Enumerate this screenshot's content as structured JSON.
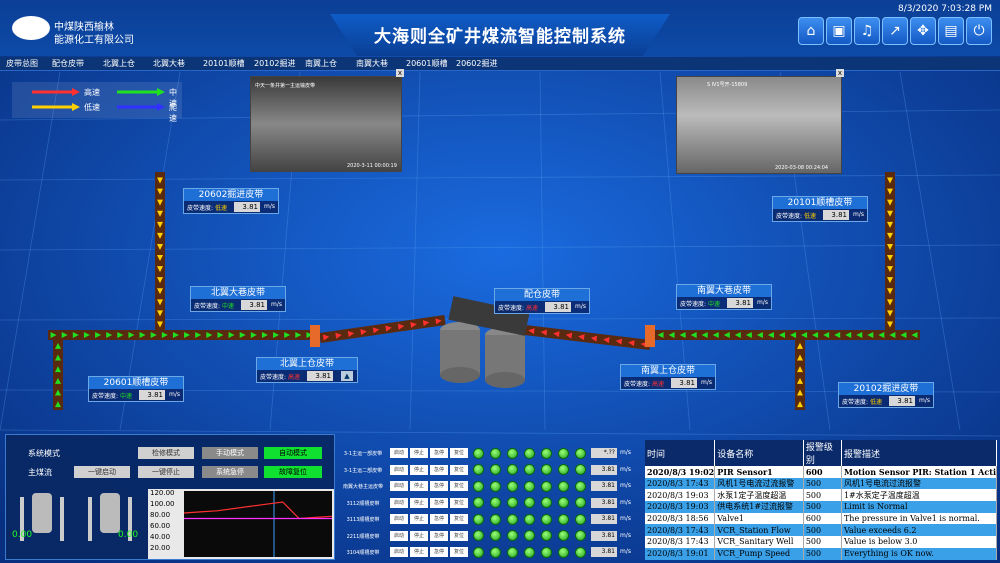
{
  "header": {
    "company_line1": "中煤陕西榆林",
    "company_line2": "能源化工有限公司",
    "title": "大海则全矿井煤流智能控制系统",
    "datetime": "8/3/2020 7:03:28 PM",
    "buttons": [
      "home-icon",
      "camera-icon",
      "alarm-bell-icon",
      "trend-chart-icon",
      "move-arrows-icon",
      "table-icon",
      "power-icon"
    ]
  },
  "tabs": [
    "皮带总图",
    "配仓皮带",
    "北翼上仓",
    "北翼大巷",
    "20101顺槽",
    "20102掘进",
    "南翼上仓",
    "南翼大巷",
    "20601顺槽",
    "20602掘进"
  ],
  "legend": {
    "high": "高速",
    "mid": "中速",
    "low": "低速",
    "creep": "爬速"
  },
  "cameras": {
    "cam1_caption": "中天一条井第一主运输皮带",
    "cam1_time": "2020-3-11 00:00:19",
    "cam2_caption": "S Ⅳ1号开-15809",
    "cam2_time": "2020-03-08 00:24:04",
    "close": "x"
  },
  "belts": [
    {
      "name": "20602掘进皮带",
      "label": "皮带速度:",
      "speed": "低速",
      "value": "3.81",
      "unit": "m/s"
    },
    {
      "name": "20101顺槽皮带",
      "label": "皮带速度:",
      "speed": "低速",
      "value": "3.81",
      "unit": "m/s"
    },
    {
      "name": "北翼大巷皮带",
      "label": "皮带速度:",
      "speed": "中速",
      "value": "3.81",
      "unit": "m/s"
    },
    {
      "name": "配仓皮带",
      "label": "皮带速度:",
      "speed": "高速",
      "value": "3.81",
      "unit": "m/s"
    },
    {
      "name": "南翼大巷皮带",
      "label": "皮带速度:",
      "speed": "中速",
      "value": "3.81",
      "unit": "m/s"
    },
    {
      "name": "北翼上仓皮带",
      "label": "皮带速度:",
      "speed": "高速",
      "value": "3.81",
      "unit": "m/s"
    },
    {
      "name": "南翼上仓皮带",
      "label": "皮带速度:",
      "speed": "高速",
      "value": "3.81",
      "unit": "m/s"
    },
    {
      "name": "20601顺槽皮带",
      "label": "皮带速度:",
      "speed": "中速",
      "value": "3.81",
      "unit": "m/s"
    },
    {
      "name": "20102掘进皮带",
      "label": "皮带速度:",
      "speed": "低速",
      "value": "3.81",
      "unit": "m/s"
    }
  ],
  "colors": {
    "high": "#ff3030",
    "mid": "#20e020",
    "low": "#ffd000",
    "creep": "#3030ff"
  },
  "control": {
    "system_mode": "系统模式",
    "main_flow": "主煤流",
    "btn_maint": "检修模式",
    "btn_manual": "手动模式",
    "btn_auto": "自动模式",
    "btn_start": "一键启动",
    "btn_stop": "一键停止",
    "btn_emergency": "系统急停",
    "btn_reset": "故障复位",
    "left_value1": "0.00",
    "left_value2": "0.00"
  },
  "chart_data": {
    "type": "line",
    "yticks": [
      "120.00",
      "100.00",
      "80.00",
      "60.00",
      "40.00",
      "20.00"
    ],
    "ylim": [
      0,
      120
    ],
    "series": [
      {
        "values": [
          80,
          82,
          84,
          88,
          92,
          96,
          100,
          70,
          72,
          74
        ],
        "color": "#ff3030"
      },
      {
        "values": [
          70,
          70,
          70,
          70,
          70,
          70,
          70,
          70,
          70,
          70
        ],
        "color": "#ff30ff"
      }
    ]
  },
  "belt_rows": [
    {
      "name": "3-1主运一部皮带",
      "value": "*.??"
    },
    {
      "name": "3-1主运二部皮带",
      "value": "3.81"
    },
    {
      "name": "南翼大巷主运皮带",
      "value": "3.81"
    },
    {
      "name": "3112顺槽皮带",
      "value": "3.81"
    },
    {
      "name": "3113顺槽皮带",
      "value": "3.81"
    },
    {
      "name": "2211顺槽皮带",
      "value": "3.81"
    },
    {
      "name": "3104顺槽皮带",
      "value": "3.81"
    }
  ],
  "row_buttons": [
    "启动",
    "停止",
    "急停",
    "复位"
  ],
  "row_unit": "m/s",
  "alarm": {
    "headers": [
      "时间",
      "设备名称",
      "报警级别",
      "报警描述"
    ],
    "rows": [
      [
        "2020/8/3 19:02",
        "PIR Sensor1",
        "600",
        "Motion Sensor PIR: Station 1 Acti"
      ],
      [
        "2020/8/3 17:43",
        "风机1号电流过流报警",
        "500",
        "风机1号电流过流报警"
      ],
      [
        "2020/8/3 19:03",
        "水泵1定子温度超温",
        "500",
        "1#水泵定子温度超温"
      ],
      [
        "2020/8/3 19:03",
        "供电系统1#过流报警",
        "500",
        "Limit is Normal"
      ],
      [
        "2020/8/3 18:56",
        "Valve1",
        "600",
        "The pressure in Valve1 is normal."
      ],
      [
        "2020/8/3 17:43",
        "VCR_Station Flow",
        "500",
        "Value exceeds 6.2"
      ],
      [
        "2020/8/3 17:43",
        "VCR_Sanitary Well",
        "500",
        "Value is below 3.0"
      ],
      [
        "2020/8/3 19:01",
        "VCR_Pump Speed",
        "500",
        "Everything is OK now."
      ]
    ]
  }
}
